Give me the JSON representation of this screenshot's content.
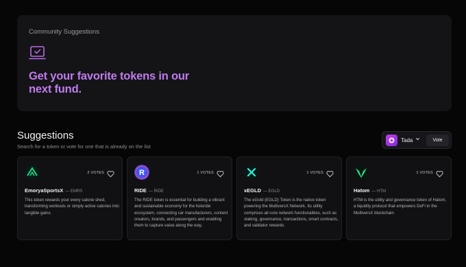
{
  "hero": {
    "label": "Community Suggestions",
    "title": "Get your favorite tokens in our next fund.",
    "icon": "laptop-check-icon"
  },
  "suggestions": {
    "title": "Suggestions",
    "subtitle": "Search for a token or vote for one that is already on the list"
  },
  "vote_panel": {
    "user_name": "Tada",
    "vote_label": "Vote"
  },
  "cards": [
    {
      "name": "EmoryaSportsX",
      "ticker": "— EMRS",
      "votes": "2 VOTES",
      "description": "This token rewards your every calorie shed, transforming workouts or simply active calories into tangible gains.",
      "logo": "emrs-logo-icon",
      "logo_color": "#1fd58a"
    },
    {
      "name": "RIDE",
      "ticker": "— RIDE",
      "votes": "1 VOTES",
      "description": "The RIDE token is essential for building a vibrant and sustainable economy for the holoride ecosystem, connecting car manufacturers, content creators, brands, and passengers and enabling them to capture value along the way.",
      "logo": "ride-logo-icon",
      "logo_color": "#3b57f5"
    },
    {
      "name": "xEGLD",
      "ticker": "— EGLD",
      "votes": "1 VOTES",
      "description": "The eGold (EGLD) Token is the native token powering the MultiversX Network. Its utility comprises all core network functionalities, such as staking, governance, transactions, smart contracts, and validator rewards.",
      "logo": "egld-logo-icon",
      "logo_color": "#23f7dd"
    },
    {
      "name": "Hatom",
      "ticker": "— HTM",
      "votes": "1 VOTES",
      "description": "HTM is the utility and governance token of Hatom, a liquidity protocol that empowers DeFi in the MultiversX blockchain",
      "logo": "hatom-logo-icon",
      "logo_color": "#2bd58c"
    }
  ]
}
